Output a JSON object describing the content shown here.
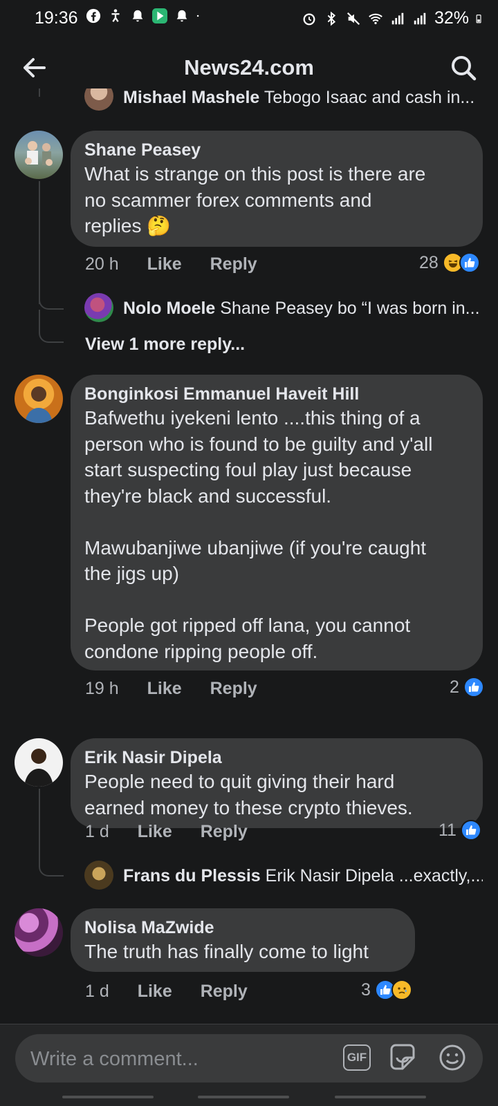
{
  "status_bar": {
    "time": "19:36",
    "battery": "32%"
  },
  "header": {
    "title": "News24.com"
  },
  "partial_reply": {
    "author": "Mishael Mashele",
    "text": "Tebogo Isaac and cash in..."
  },
  "comments": [
    {
      "author": "Shane Peasey",
      "text": "What is strange on this post is there are\nno scammer forex comments and\nreplies 🤔",
      "time": "20 h",
      "like_label": "Like",
      "reply_label": "Reply",
      "reaction_count": "28",
      "reactions": [
        "haha",
        "like"
      ],
      "replies": [
        {
          "author": "Nolo Moele",
          "text": "Shane Peasey  bo “I was born in..."
        }
      ],
      "view_more": "View 1 more reply..."
    },
    {
      "author": "Bonginkosi Emmanuel Haveit Hill",
      "text": "Bafwethu iyekeni lento ....this thing of a\nperson who is found to be guilty and y'all\nstart suspecting foul play just because\nthey're black and successful.\n\nMawubanjiwe ubanjiwe (if you're caught\nthe jigs up)\n\nPeople got ripped off lana, you cannot\ncondone ripping people off.",
      "time": "19 h",
      "like_label": "Like",
      "reply_label": "Reply",
      "reaction_count": "2",
      "reactions": [
        "like"
      ]
    },
    {
      "author": "Erik Nasir Dipela",
      "text": "People need to quit giving their hard\nearned money to these crypto thieves.",
      "time": "1 d",
      "like_label": "Like",
      "reply_label": "Reply",
      "reaction_count": "11",
      "reactions": [
        "like"
      ],
      "replies": [
        {
          "author": "Frans du Plessis",
          "text": "Erik Nasir Dipela ...exactly,..."
        }
      ]
    },
    {
      "author": "Nolisa MaZwide",
      "text": "The truth has finally come to light",
      "time": "1 d",
      "like_label": "Like",
      "reply_label": "Reply",
      "reaction_count": "3",
      "reactions": [
        "like",
        "sad"
      ]
    }
  ],
  "composer": {
    "placeholder": "Write a comment...",
    "gif_label": "GIF"
  },
  "colors": {
    "background": "#18191a",
    "bubble": "#3a3b3c",
    "like_blue": "#2d88ff",
    "secondary_text": "#b0b3b8"
  }
}
